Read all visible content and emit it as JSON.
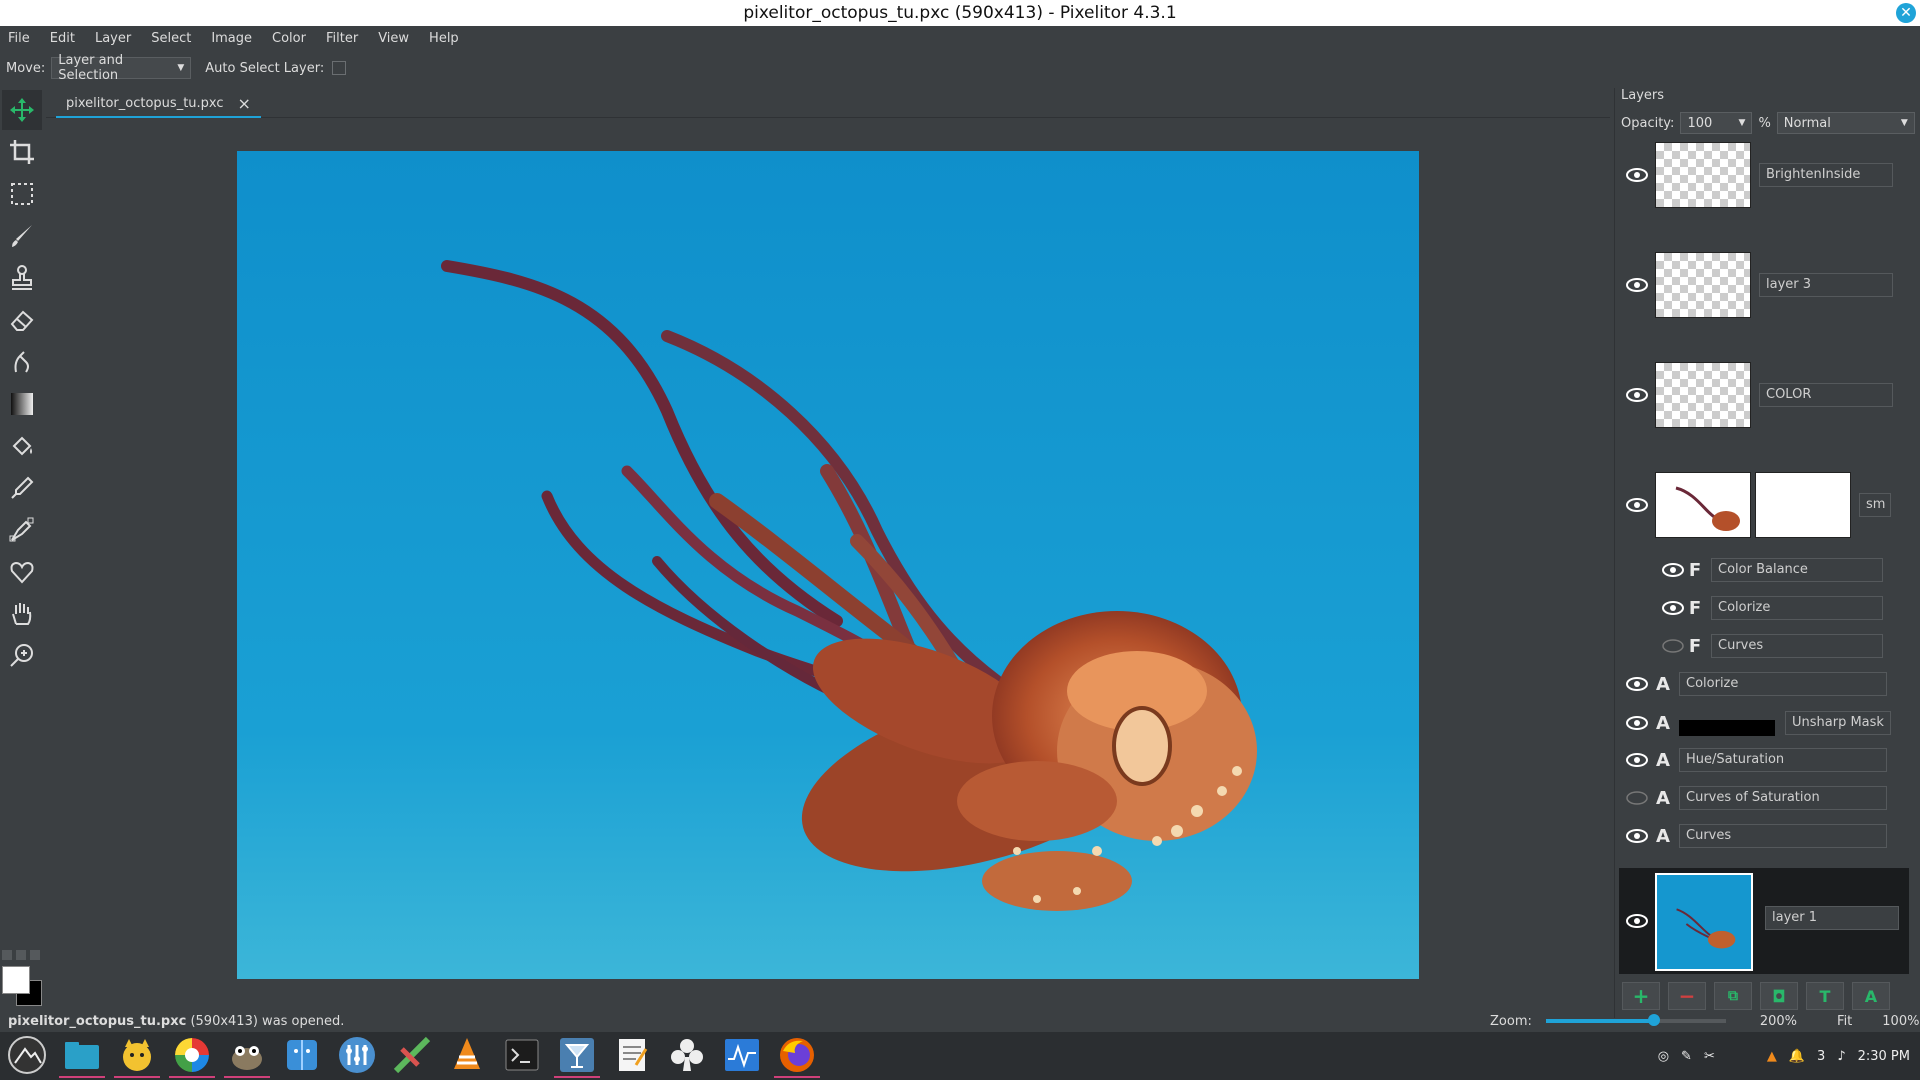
{
  "window": {
    "title": "pixelitor_octopus_tu.pxc (590x413) - Pixelitor 4.3.1"
  },
  "menu": [
    "File",
    "Edit",
    "Layer",
    "Select",
    "Image",
    "Color",
    "Filter",
    "View",
    "Help"
  ],
  "toolbar": {
    "move_label": "Move:",
    "move_mode": "Layer and Selection",
    "auto_select_label": "Auto Select Layer:"
  },
  "tools": [
    "move-icon",
    "crop-icon",
    "selection-icon",
    "brush-icon",
    "clone-stamp-icon",
    "eraser-icon",
    "smudge-icon",
    "gradient-icon",
    "paint-bucket-icon",
    "color-picker-icon",
    "pen-icon",
    "shapes-icon",
    "hand-icon",
    "zoom-icon"
  ],
  "tab": {
    "label": "pixelitor_octopus_tu.pxc",
    "close": "×"
  },
  "layers": {
    "title": "Layers",
    "opacity_label": "Opacity:",
    "opacity_value": "100",
    "percent": "%",
    "blend_mode": "Normal",
    "items": [
      {
        "name": "BrightenInside",
        "visible": true,
        "type": "image"
      },
      {
        "name": "layer 3",
        "visible": true,
        "type": "image"
      },
      {
        "name": "COLOR",
        "visible": true,
        "type": "image"
      },
      {
        "name": "sm",
        "visible": true,
        "type": "smart"
      },
      {
        "name": "Color Balance",
        "visible": true,
        "type": "filter",
        "badge": "F"
      },
      {
        "name": "Colorize",
        "visible": true,
        "type": "filter",
        "badge": "F"
      },
      {
        "name": "Curves",
        "visible": false,
        "type": "filter",
        "badge": "F"
      },
      {
        "name": "Colorize",
        "visible": true,
        "type": "adjustment",
        "badge": "A"
      },
      {
        "name": "Unsharp Mask",
        "visible": true,
        "type": "adjustment",
        "badge": "A"
      },
      {
        "name": "Hue/Saturation",
        "visible": true,
        "type": "adjustment",
        "badge": "A"
      },
      {
        "name": "Curves of Saturation",
        "visible": false,
        "type": "adjustment",
        "badge": "A"
      },
      {
        "name": "Curves",
        "visible": true,
        "type": "adjustment",
        "badge": "A"
      },
      {
        "name": "layer 1",
        "visible": true,
        "type": "image",
        "selected": true
      }
    ],
    "buttons": [
      "add-layer-icon",
      "delete-layer-icon",
      "duplicate-layer-icon",
      "mask-icon",
      "text-layer-icon",
      "adjustment-layer-icon"
    ]
  },
  "status": {
    "filename": "pixelitor_octopus_tu.pxc",
    "message": " (590x413) was opened.",
    "zoom_label": "Zoom:",
    "zoom_slider": 0.6,
    "zoom_value": "200%",
    "fit": "Fit",
    "full": "100%"
  },
  "taskbar": {
    "apps": [
      "launcher-icon",
      "files-icon",
      "cat-app-icon",
      "color-wheel-icon",
      "gimp-icon",
      "finder-icon",
      "settings-icon",
      "inkscape-icon",
      "vlc-icon",
      "terminal-icon",
      "cocktail-icon",
      "text-editor-icon",
      "cards-icon",
      "system-monitor-icon",
      "firefox-icon"
    ],
    "badge_count": "3",
    "time": "2:30 PM"
  },
  "colors": {
    "accent": "#1fa3d8",
    "background": "#3b3f42",
    "selected_layer": "#1a1c1e"
  }
}
